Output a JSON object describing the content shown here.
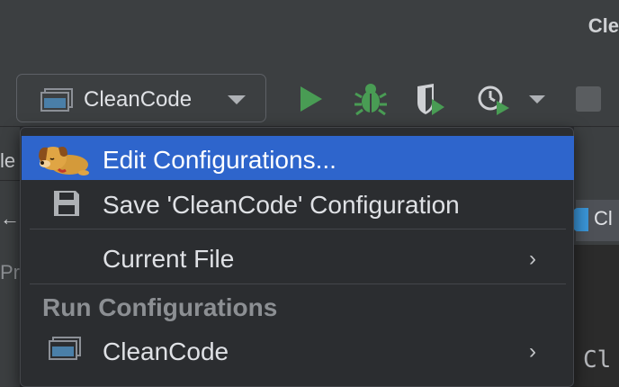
{
  "window": {
    "title_fragment": "Cle"
  },
  "toolbar": {
    "run_config": {
      "label": "CleanCode",
      "icon": "run-config-window-icon"
    },
    "buttons": [
      {
        "name": "run",
        "icon": "play-icon",
        "color": "#499c54"
      },
      {
        "name": "debug",
        "icon": "bug-icon",
        "color": "#499c54"
      },
      {
        "name": "coverage",
        "icon": "shield-play-icon",
        "color": "#499c54"
      },
      {
        "name": "profile",
        "icon": "stopwatch-play-icon",
        "color": "#499c54"
      },
      {
        "name": "stop",
        "icon": "stop-icon",
        "color": "#5a5d60"
      }
    ]
  },
  "background": {
    "left_tab_text": "le",
    "left_arrow": "←",
    "left_label": "Pro",
    "editor_tab_label": "Cl",
    "editor_code": "Cl"
  },
  "menu": {
    "items": [
      {
        "label": "Edit Configurations...",
        "icon": "dog-mascot-icon",
        "selected": true
      },
      {
        "label": "Save 'CleanCode' Configuration",
        "icon": "save-floppy-icon"
      },
      {
        "label": "Current File",
        "submenu": true,
        "arrow": "›"
      }
    ],
    "section_header": "Run Configurations",
    "configurations": [
      {
        "label": "CleanCode",
        "icon": "run-config-window-icon",
        "submenu": true,
        "arrow": "›"
      }
    ]
  },
  "colors": {
    "accent": "#2e65cc",
    "run_green": "#499c54",
    "background": "#2b2d30"
  }
}
